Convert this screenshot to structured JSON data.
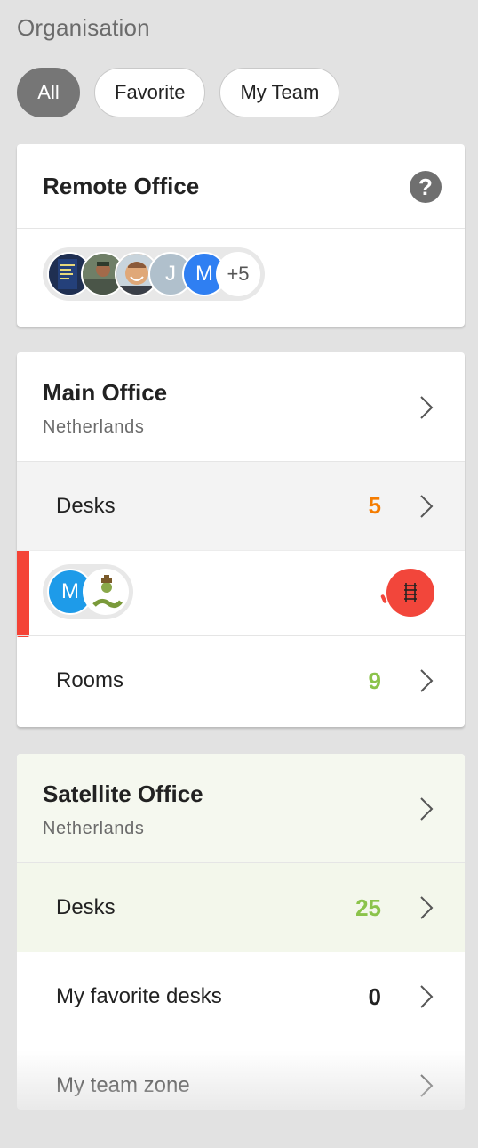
{
  "header": {
    "title": "Organisation"
  },
  "filters": [
    {
      "label": "All",
      "active": true
    },
    {
      "label": "Favorite",
      "active": false
    },
    {
      "label": "My Team",
      "active": false
    }
  ],
  "remote_office": {
    "title": "Remote Office",
    "help_icon": "question-circle-icon",
    "avatars": [
      {
        "type": "photo",
        "icon": "photo-book-cover",
        "color": "#2a3c61"
      },
      {
        "type": "photo",
        "icon": "photo-outdoor",
        "color": "#5c6b55"
      },
      {
        "type": "photo",
        "icon": "photo-smiling-man",
        "color": "#d8a070"
      },
      {
        "type": "initial",
        "initial": "J",
        "color": "#b0c0cc"
      },
      {
        "type": "initial",
        "initial": "M",
        "color": "#2f7ff2"
      }
    ],
    "more_count": "+5"
  },
  "main_office": {
    "title": "Main Office",
    "subtitle": "Netherlands",
    "desks": {
      "label": "Desks",
      "count": "5",
      "color": "#f57c00"
    },
    "avatars": [
      {
        "type": "initial",
        "initial": "M",
        "color": "#1e9be9"
      },
      {
        "type": "photo",
        "icon": "cartoon-snake-icon",
        "color": "#ffffff"
      }
    ],
    "status_icon": "railway-track-icon",
    "status_color": "#f2463b",
    "rooms": {
      "label": "Rooms",
      "count": "9",
      "color": "#8bc34a"
    }
  },
  "satellite_office": {
    "title": "Satellite Office",
    "subtitle": "Netherlands",
    "desks": {
      "label": "Desks",
      "count": "25",
      "color": "#8bc34a"
    },
    "favorite_desks": {
      "label": "My favorite desks",
      "count": "0"
    },
    "team_zone": {
      "label": "My team zone"
    }
  }
}
